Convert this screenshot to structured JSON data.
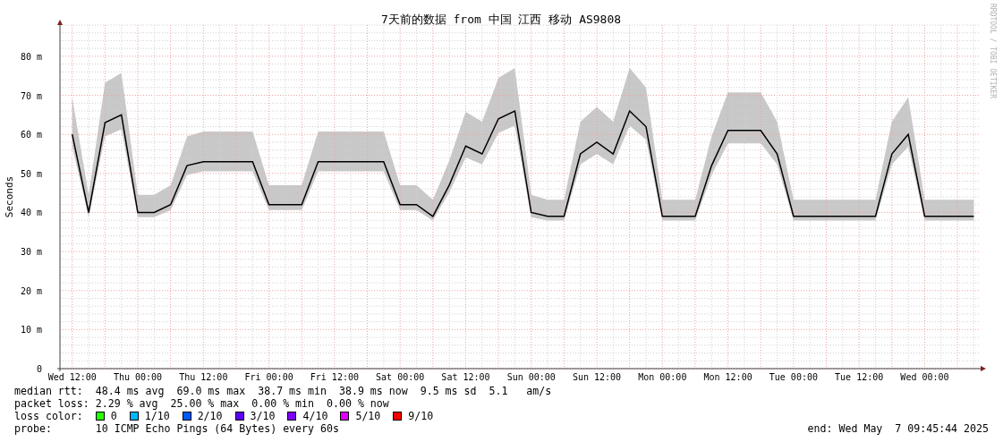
{
  "title": "7天前的数据 from 中国 江西 移动 AS9808",
  "watermark_side": "RRDTOOL / TOBI OETIKER",
  "chart": {
    "chart_data": {
      "type": "line",
      "grid": true,
      "ylabel": "Seconds",
      "ylim": [
        0,
        88
      ],
      "yticks": [
        {
          "value": 0,
          "label": "0"
        },
        {
          "value": 10,
          "label": "10 m"
        },
        {
          "value": 20,
          "label": "20 m"
        },
        {
          "value": 30,
          "label": "30 m"
        },
        {
          "value": 40,
          "label": "40 m"
        },
        {
          "value": 50,
          "label": "50 m"
        },
        {
          "value": 60,
          "label": "60 m"
        },
        {
          "value": 70,
          "label": "70 m"
        },
        {
          "value": 80,
          "label": "80 m"
        }
      ],
      "categories": [
        "Wed 12:00",
        null,
        null,
        null,
        "Thu 00:00",
        null,
        null,
        null,
        "Thu 12:00",
        null,
        null,
        null,
        "Fri 00:00",
        null,
        null,
        null,
        "Fri 12:00",
        null,
        null,
        null,
        "Sat 00:00",
        null,
        null,
        null,
        "Sat 12:00",
        null,
        null,
        null,
        "Sun 00:00",
        null,
        null,
        null,
        "Sun 12:00",
        null,
        null,
        null,
        "Mon 00:00",
        null,
        null,
        null,
        "Mon 12:00",
        null,
        null,
        null,
        "Tue 00:00",
        null,
        null,
        null,
        "Tue 12:00",
        null,
        null,
        null,
        "Wed 00:00",
        null,
        null,
        null
      ],
      "series": [
        {
          "color": "#000000",
          "values": [
            60,
            40,
            63,
            65,
            40,
            40,
            42,
            52,
            53,
            53,
            53,
            53,
            42,
            42,
            42,
            53,
            53,
            53,
            53,
            53,
            42,
            42,
            39,
            47,
            57,
            55,
            64,
            66,
            40,
            39,
            39,
            55,
            58,
            55,
            66,
            62,
            39,
            39,
            39,
            52,
            61,
            61,
            61,
            55,
            39,
            39,
            39,
            39,
            39,
            39,
            55,
            60,
            39,
            39,
            39,
            39
          ]
        }
      ]
    }
  },
  "legend": {
    "rows": [
      {
        "kind": "text",
        "label": "median rtt:",
        "value": "48.4 ms avg  69.0 ms max  38.7 ms min  38.9 ms now  9.5 ms sd  5.1   am/s"
      },
      {
        "kind": "text",
        "label": "packet loss:",
        "value": "2.29 % avg  25.00 % max  0.00 % min  0.00 % now"
      },
      {
        "kind": "colors",
        "label": "loss color:",
        "items": [
          {
            "label": "0",
            "color": "#26ff00"
          },
          {
            "label": "1/10",
            "color": "#00b8ff"
          },
          {
            "label": "2/10",
            "color": "#0059ff"
          },
          {
            "label": "3/10",
            "color": "#5e00ff"
          },
          {
            "label": "4/10",
            "color": "#7e00ff"
          },
          {
            "label": "5/10",
            "color": "#dd00ff"
          },
          {
            "label": "9/10",
            "color": "#ff0000"
          }
        ]
      },
      {
        "kind": "text",
        "label": "probe:",
        "value": "10 ICMP Echo Pings (64 Bytes) every 60s"
      }
    ],
    "end": "end: Wed May  7 09:45:44 2025"
  }
}
